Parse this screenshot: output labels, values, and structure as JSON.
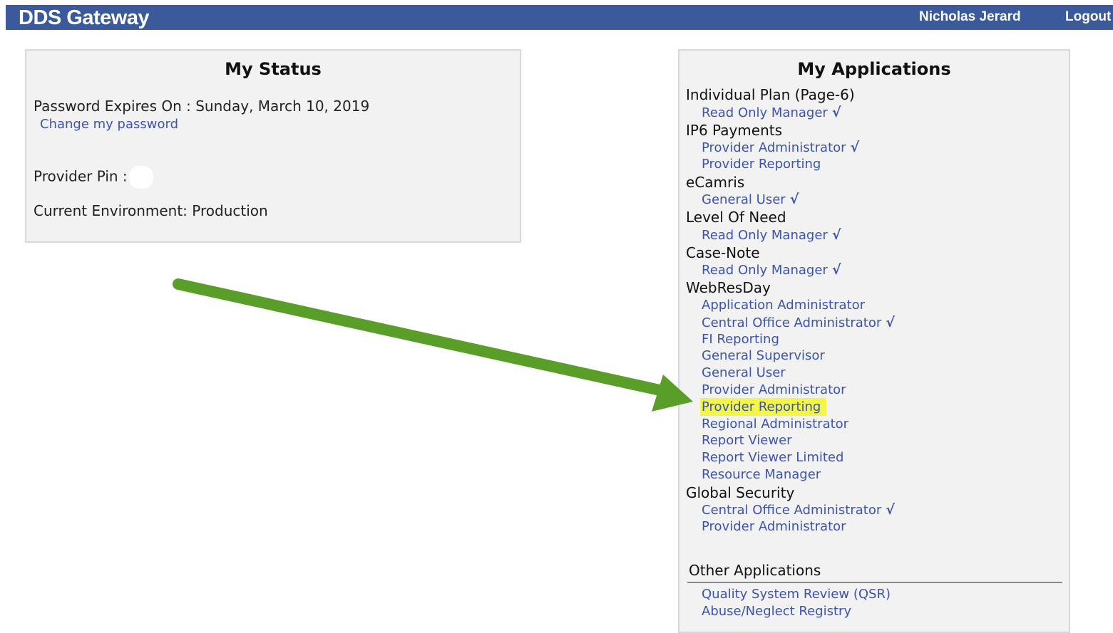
{
  "header": {
    "title": "DDS Gateway",
    "user_name": "Nicholas Jerard",
    "logout_label": "Logout",
    "bar_color": "#3a5a9c"
  },
  "status": {
    "title": "My Status",
    "password_expires": "Password Expires On : Sunday, March 10, 2019",
    "change_password_link": "Change my password",
    "provider_pin_label": "Provider Pin :",
    "environment": "Current Environment: Production"
  },
  "applications": {
    "title": "My Applications",
    "check_mark": "√",
    "groups": [
      {
        "name": "Individual Plan (Page-6)",
        "roles": [
          {
            "label": "Read Only Manager",
            "checked": true
          }
        ]
      },
      {
        "name": "IP6 Payments",
        "roles": [
          {
            "label": "Provider Administrator",
            "checked": true
          },
          {
            "label": "Provider Reporting",
            "checked": false
          }
        ]
      },
      {
        "name": "eCamris",
        "roles": [
          {
            "label": "General User",
            "checked": true
          }
        ]
      },
      {
        "name": "Level Of Need",
        "roles": [
          {
            "label": "Read Only Manager",
            "checked": true
          }
        ]
      },
      {
        "name": "Case-Note",
        "roles": [
          {
            "label": "Read Only Manager",
            "checked": true
          }
        ]
      },
      {
        "name": "WebResDay",
        "roles": [
          {
            "label": "Application Administrator",
            "checked": false
          },
          {
            "label": "Central Office Administrator",
            "checked": true
          },
          {
            "label": "FI Reporting",
            "checked": false
          },
          {
            "label": "General Supervisor",
            "checked": false
          },
          {
            "label": "General User",
            "checked": false
          },
          {
            "label": "Provider Administrator",
            "checked": false
          },
          {
            "label": "Provider Reporting",
            "checked": false,
            "highlighted": true
          },
          {
            "label": "Regional Administrator",
            "checked": false
          },
          {
            "label": "Report Viewer",
            "checked": false
          },
          {
            "label": "Report Viewer Limited",
            "checked": false
          },
          {
            "label": "Resource Manager",
            "checked": false
          }
        ]
      },
      {
        "name": "Global Security",
        "roles": [
          {
            "label": "Central Office Administrator",
            "checked": true
          },
          {
            "label": "Provider Administrator",
            "checked": false
          }
        ]
      }
    ]
  },
  "other_applications": {
    "title": "Other Applications",
    "links": [
      "Quality System Review (QSR)",
      "Abuse/Neglect Registry"
    ]
  },
  "annotation": {
    "arrow_color": "#5a9e2a",
    "highlight_color": "#f3f54a"
  }
}
